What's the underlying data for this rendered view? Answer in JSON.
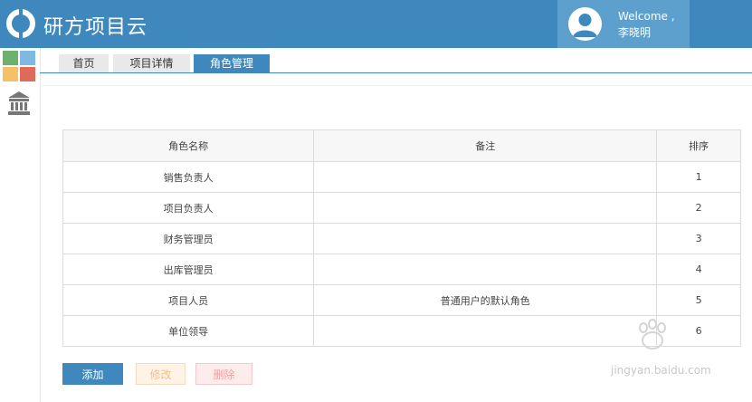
{
  "app": {
    "title": "研方项目云"
  },
  "user": {
    "welcome": "Welcome ,",
    "name": "李晓明"
  },
  "colors": {
    "header": "#3f88bd",
    "user_box": "#5da0cd",
    "tiles": [
      "#6cb26c",
      "#7fb8e0",
      "#f5c066",
      "#e06a5a"
    ]
  },
  "sidebar": {
    "items": [
      {
        "icon": "app-tiles-icon"
      },
      {
        "icon": "bank-icon"
      }
    ]
  },
  "tabs": [
    {
      "label": "首页",
      "active": false
    },
    {
      "label": "项目详情",
      "active": false
    },
    {
      "label": "角色管理",
      "active": true
    }
  ],
  "table": {
    "headers": [
      "角色名称",
      "备注",
      "排序"
    ],
    "rows": [
      {
        "name": "销售负责人",
        "remark": "",
        "order": "1"
      },
      {
        "name": "项目负责人",
        "remark": "",
        "order": "2"
      },
      {
        "name": "财务管理员",
        "remark": "",
        "order": "3"
      },
      {
        "name": "出库管理员",
        "remark": "",
        "order": "4"
      },
      {
        "name": "项目人员",
        "remark": "普通用户的默认角色",
        "order": "5"
      },
      {
        "name": "单位领导",
        "remark": "",
        "order": "6"
      }
    ]
  },
  "buttons": {
    "add": "添加",
    "edit": "修改",
    "delete": "删除"
  },
  "watermark": {
    "text": "jingyan.baidu.com"
  }
}
